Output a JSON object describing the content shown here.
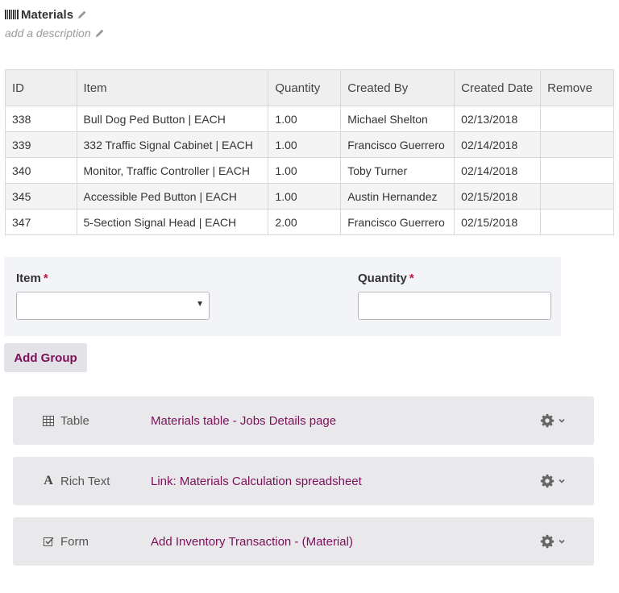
{
  "header": {
    "title": "Materials",
    "description_placeholder": "add a description"
  },
  "table": {
    "columns": [
      "ID",
      "Item",
      "Quantity",
      "Created By",
      "Created Date",
      "Remove"
    ],
    "rows": [
      [
        "338",
        "Bull Dog Ped Button | EACH",
        "1.00",
        "Michael Shelton",
        "02/13/2018",
        ""
      ],
      [
        "339",
        "332 Traffic Signal Cabinet | EACH",
        "1.00",
        "Francisco Guerrero",
        "02/14/2018",
        ""
      ],
      [
        "340",
        "Monitor, Traffic Controller | EACH",
        "1.00",
        "Toby Turner",
        "02/14/2018",
        ""
      ],
      [
        "345",
        "Accessible Ped Button | EACH",
        "1.00",
        "Austin Hernandez",
        "02/15/2018",
        ""
      ],
      [
        "347",
        "5-Section Signal Head | EACH",
        "2.00",
        "Francisco Guerrero",
        "02/15/2018",
        ""
      ]
    ]
  },
  "form": {
    "item_label": "Item",
    "item_required": "*",
    "item_value": "",
    "quantity_label": "Quantity",
    "quantity_required": "*",
    "quantity_value": ""
  },
  "add_group_label": "Add Group",
  "widgets": [
    {
      "type": "Table",
      "icon": "table-icon",
      "title": "Materials table - Jobs Details page"
    },
    {
      "type": "Rich Text",
      "icon": "rich-text-icon",
      "title": "Link: Materials Calculation spreadsheet"
    },
    {
      "type": "Form",
      "icon": "form-icon",
      "title": "Add Inventory Transaction - (Material)"
    }
  ],
  "colors": {
    "accent": "#7d0f5a",
    "required": "#c0143c",
    "panel": "#f3f4f7",
    "widget_bg": "#e9e9ec"
  }
}
